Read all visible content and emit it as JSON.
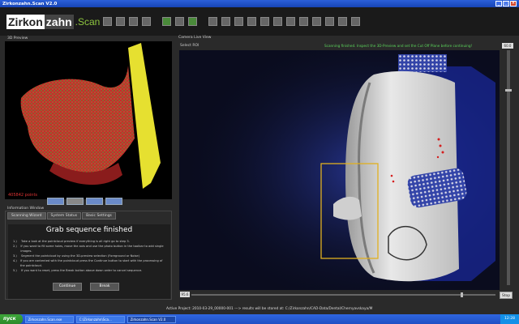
{
  "window": {
    "title": "Zirkonzahn.Scan V2.0"
  },
  "logo": {
    "part1": "Zirkon",
    "part2": "zahn",
    "part3": ".Scan"
  },
  "preview3d": {
    "title": "3D Preview",
    "points": "405842 points"
  },
  "info": {
    "title": "Information Window",
    "tabs": [
      "Scanning Wizard",
      "System Status",
      "Basic Settings"
    ],
    "heading": "Grab sequence finished",
    "steps": [
      {
        "n": "1.)",
        "text": "Take a look at the pointcloud preview if everything is all right go to step 3."
      },
      {
        "n": "2.)",
        "text": "If you want to fill some holes, move the axis and use the photo button in the toolbar to add single images."
      },
      {
        "n": "3.)",
        "text": "Segment the pointcloud by using the 3D-preview selection (Foreground or Noise)"
      },
      {
        "n": "4.)",
        "text": "If you are contented with the pointcloud press the Continue button to start with the processing of the pointcloud."
      },
      {
        "n": "5.)",
        "text": "If you want to reset, press the Break button above down order to cancel sequence."
      }
    ],
    "continue_label": "Continue",
    "break_label": "Break"
  },
  "camera": {
    "title": "Camera Live View",
    "select_roi": "Select ROI",
    "message": "Scanning finished. Inspect the 3D-Preview and set the Cut Off Plane before continuing!",
    "fps": "60.0",
    "zoom": "95.6",
    "stop_label": "Stop"
  },
  "status": {
    "text": "Active Project:  2010-03-29_00000-001  ---> results will be stored at:  C:/Zirkonzahn/CAD-Data/Dental/Chernyavskaya/M"
  },
  "taskbar": {
    "start": "пуск",
    "tasks": [
      "Zirkonzahn.Scan.exe",
      "C:\\Zirkonzahn\\Sca...",
      "Zirkonzahn.Scan V2.0"
    ],
    "clock": "12:28"
  }
}
